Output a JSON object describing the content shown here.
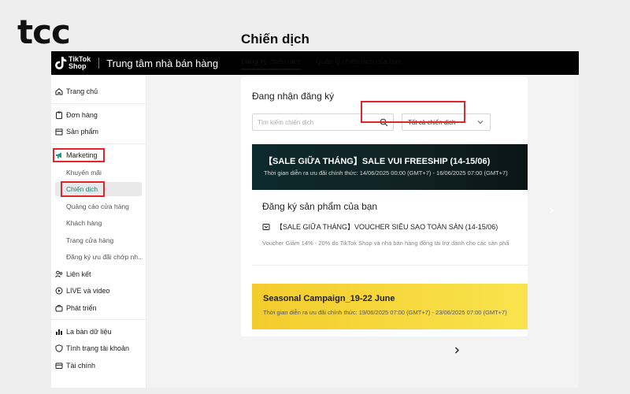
{
  "brand": {
    "logo_text": "tcc"
  },
  "topbar": {
    "logo_line1": "TikTok",
    "logo_line2": "Shop",
    "title": "Trung tâm nhà bán hàng"
  },
  "sidebar": {
    "items": [
      {
        "label": "Trang chủ",
        "icon": "home-icon"
      },
      {
        "label": "Đơn hàng",
        "icon": "clipboard-icon"
      },
      {
        "label": "Sản phẩm",
        "icon": "box-icon"
      },
      {
        "label": "Marketing",
        "icon": "megaphone-icon"
      },
      {
        "label": "Liên kết",
        "icon": "users-link-icon"
      },
      {
        "label": "LIVE và video",
        "icon": "video-icon"
      },
      {
        "label": "Phát triển",
        "icon": "rocket-icon"
      },
      {
        "label": "La bàn dữ liệu",
        "icon": "chart-icon"
      },
      {
        "label": "Tình trạng tài khoản",
        "icon": "shield-icon"
      },
      {
        "label": "Tài chính",
        "icon": "wallet-icon"
      }
    ],
    "marketing_sub": [
      "Khuyến mãi",
      "Chiến dịch",
      "Quảng cáo cửa hàng",
      "Khách hàng",
      "Trang cửa hàng",
      "Đăng ký ưu đãi chớp nh..."
    ]
  },
  "main": {
    "page_title": "Chiến dịch",
    "tabs": [
      "Đăng ký chiến dịch",
      "Quản lý chiến dịch của bạn"
    ],
    "section_title": "Đang nhận đăng ký",
    "search_placeholder": "Tìm kiếm chiến dịch",
    "filter_selected": "Tất cả chiến dịch",
    "banner1": {
      "title": "【SALE GIỮA THÁNG】SALE VUI FREESHIP (14-15/06)",
      "subtitle": "Thời gian diễn ra ưu đãi chính thức: 14/06/2025 00:00 (GMT+7) - 16/06/2025 07:00 (GMT+7)"
    },
    "register_title": "Đăng ký sản phẩm của bạn",
    "voucher_title": "【SALE GIỮA THÁNG】VOUCHER SIÊU SAO TOÀN SÀN (14-15/06)",
    "voucher_desc": "Voucher Giảm 14% - 20% do TikTok Shop và nhà bán hàng đồng tài trợ dành cho các sản phẩ",
    "banner2": {
      "title": "Seasonal Campaign_19-22 June",
      "subtitle": "Thời gian diễn ra ưu đãi chính thức: 19/06/2025 07:00 (GMT+7) - 23/06/2025 07:00 (GMT+7)"
    }
  },
  "colors": {
    "highlight_box": "#e0262d",
    "active_submenu_text": "#1a7f78",
    "topbar_bg": "#000000",
    "banner_yellow": "#f6d83c",
    "banner_dark": "#102224"
  }
}
